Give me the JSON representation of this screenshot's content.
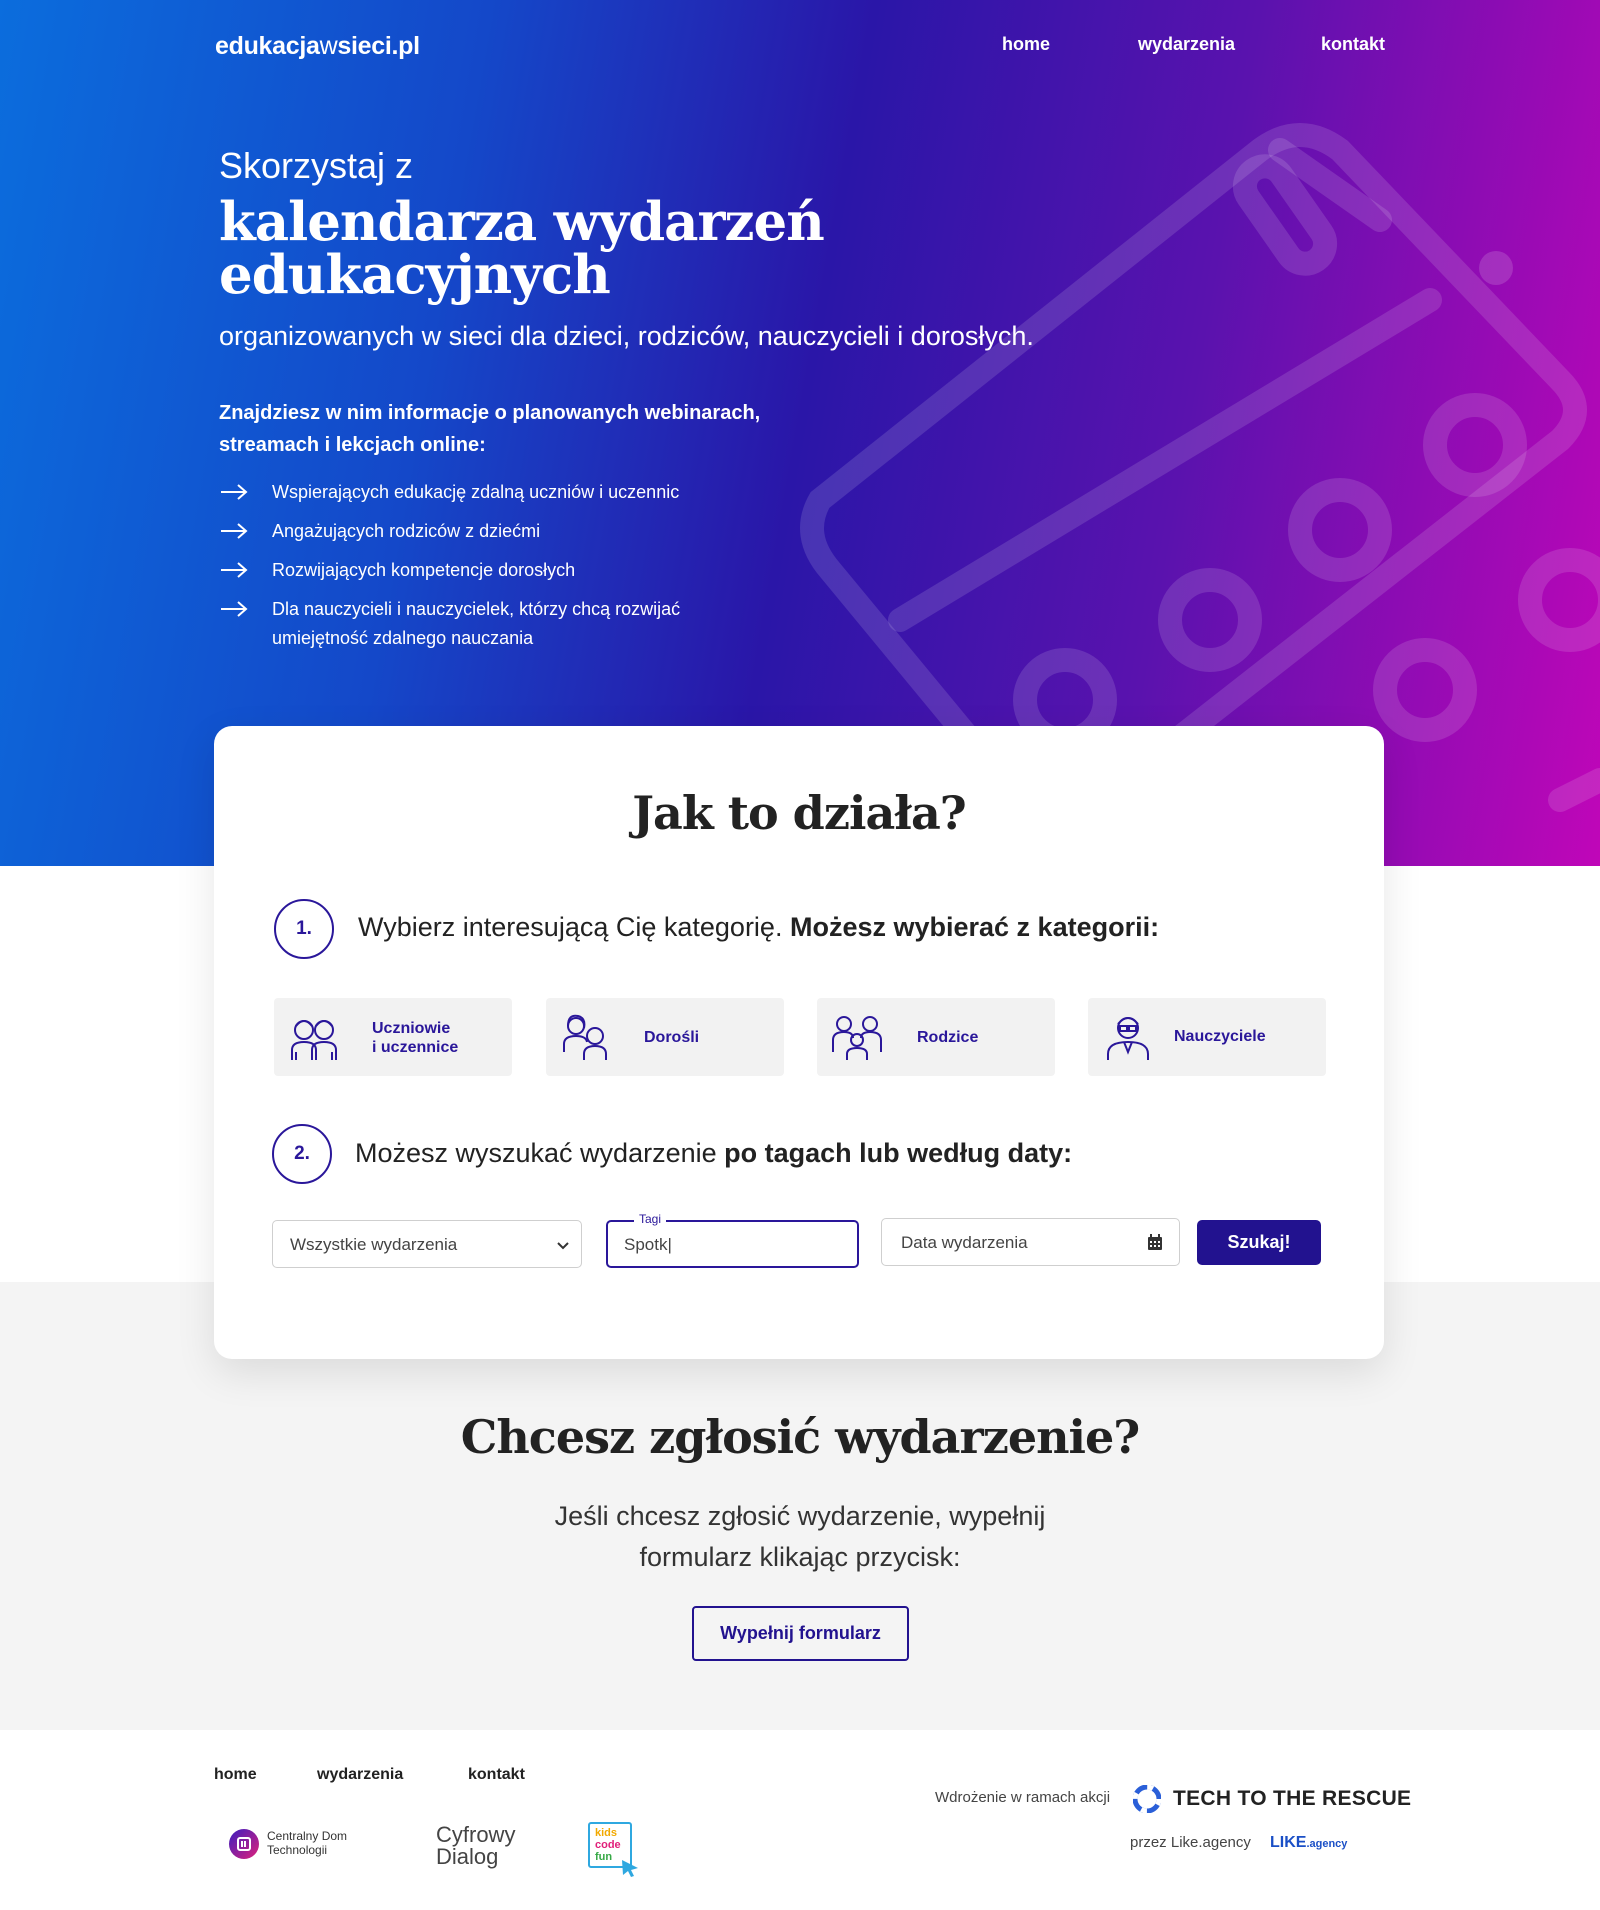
{
  "brand": {
    "name_bold_1": "edukacja",
    "name_light": "w",
    "name_bold_2": "sieci.pl"
  },
  "nav": {
    "home": "home",
    "events": "wydarzenia",
    "contact": "kontakt"
  },
  "hero": {
    "pre_title": "Skorzystaj z",
    "title": "kalendarza wydarzeń edukacyjnych",
    "subtitle": "organizowanych w sieci dla dzieci, rodziców, nauczycieli i dorosłych.",
    "lead": "Znajdziesz w nim informacje o planowanych webinarach, streamach i lekcjach online:",
    "items": [
      "Wspierających edukację zdalną uczniów i uczennic",
      "Angażujących rodziców z dziećmi",
      "Rozwijających kompetencje dorosłych",
      "Dla nauczycieli i nauczycielek, którzy chcą rozwijać umiejętność zdalnego nauczania"
    ]
  },
  "how": {
    "title": "Jak to działa?",
    "step1": {
      "num": "1.",
      "text": "Wybierz interesującą Cię kategorię.",
      "bold": "Możesz wybierać z kategorii:"
    },
    "categories": [
      {
        "icon": "students-icon",
        "label_1": "Uczniowie",
        "label_2": "i uczennice"
      },
      {
        "icon": "adults-icon",
        "label": "Dorośli"
      },
      {
        "icon": "parents-icon",
        "label": "Rodzice"
      },
      {
        "icon": "teacher-icon",
        "label": "Nauczyciele"
      }
    ],
    "step2": {
      "num": "2.",
      "text": "Możesz wyszukać wydarzenie",
      "bold": "po tagach lub według daty:"
    },
    "filters": {
      "select_value": "Wszystkie wydarzenia",
      "tags_legend": "Tagi",
      "tags_value": "Spotk|",
      "date_placeholder": "Data wydarzenia",
      "search_button": "Szukaj!"
    }
  },
  "submit": {
    "title": "Chcesz zgłosić wydarzenie?",
    "text": "Jeśli chcesz zgłosić wydarzenie, wypełnij formularz klikając przycisk:",
    "button": "Wypełnij formularz"
  },
  "footer": {
    "nav": {
      "home": "home",
      "events": "wydarzenia",
      "contact": "kontakt"
    },
    "partners": {
      "cdt_1": "Centralny Dom",
      "cdt_2": "Technologii",
      "cd_1": "Cyfrowy",
      "cd_2": "Dialog",
      "kcf_1": "kids",
      "kcf_2": "code",
      "kcf_3": "fun"
    },
    "impl_text": "Wdrożenie w ramach akcji",
    "ttr": "TECH TO THE RESCUE",
    "by_text": "przez Like.agency",
    "like_logo": "LIKE",
    "like_suffix": ".agency"
  },
  "colors": {
    "primary": "#22128f",
    "gradient_start": "#0b6ddd",
    "gradient_end": "#c006b8"
  }
}
